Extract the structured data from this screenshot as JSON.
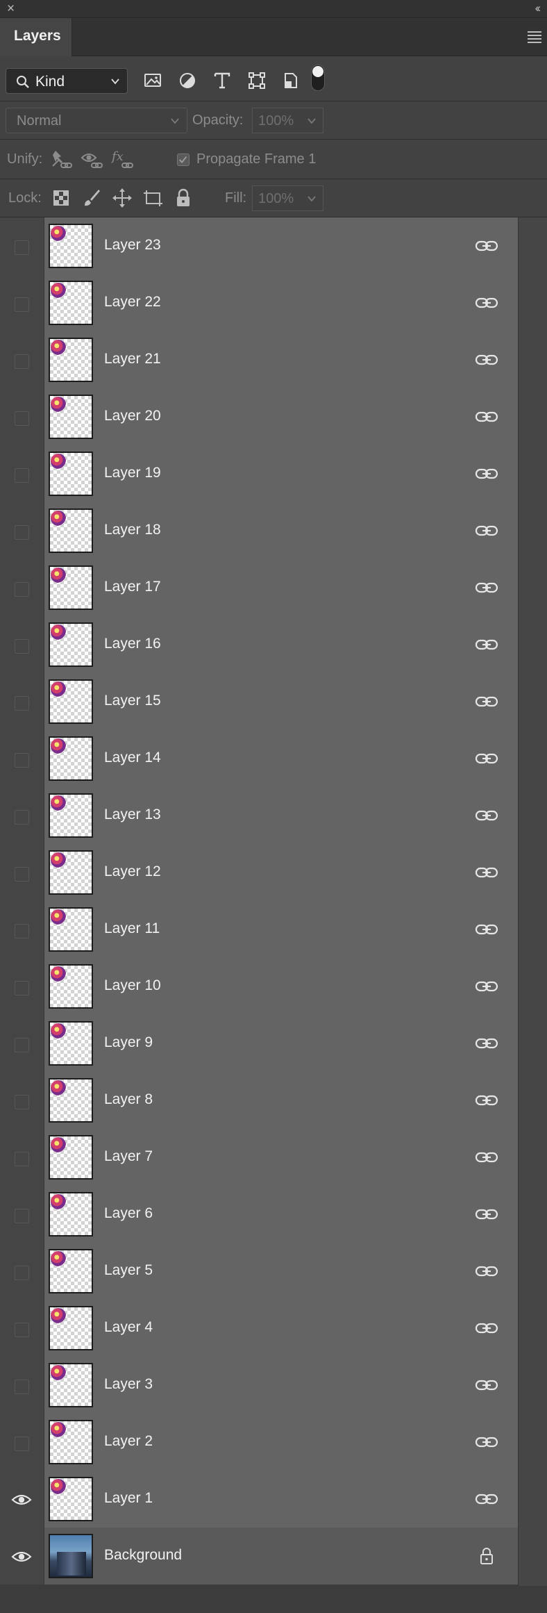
{
  "window": {
    "close_glyph": "×",
    "collapse_glyph": "‹‹"
  },
  "panel": {
    "title": "Layers",
    "menu_icon": "hamburger-menu-icon"
  },
  "filter": {
    "kind_label": "Kind",
    "icons": [
      "image-filter-icon",
      "adjustment-filter-icon",
      "type-filter-icon",
      "shape-filter-icon",
      "smart-object-filter-icon"
    ]
  },
  "blend": {
    "mode": "Normal",
    "opacity_label": "Opacity:",
    "opacity_value": "100%"
  },
  "unify": {
    "label": "Unify:",
    "propagate_label": "Propagate Frame 1",
    "propagate_checked": true
  },
  "lock": {
    "label": "Lock:",
    "fill_label": "Fill:",
    "fill_value": "100%"
  },
  "layers": [
    {
      "name": "Layer 23",
      "visible": false,
      "locked": false
    },
    {
      "name": "Layer 22",
      "visible": false,
      "locked": false
    },
    {
      "name": "Layer 21",
      "visible": false,
      "locked": false
    },
    {
      "name": "Layer 20",
      "visible": false,
      "locked": false
    },
    {
      "name": "Layer 19",
      "visible": false,
      "locked": false
    },
    {
      "name": "Layer 18",
      "visible": false,
      "locked": false
    },
    {
      "name": "Layer 17",
      "visible": false,
      "locked": false
    },
    {
      "name": "Layer 16",
      "visible": false,
      "locked": false
    },
    {
      "name": "Layer 15",
      "visible": false,
      "locked": false
    },
    {
      "name": "Layer 14",
      "visible": false,
      "locked": false
    },
    {
      "name": "Layer 13",
      "visible": false,
      "locked": false
    },
    {
      "name": "Layer 12",
      "visible": false,
      "locked": false
    },
    {
      "name": "Layer 11",
      "visible": false,
      "locked": false
    },
    {
      "name": "Layer 10",
      "visible": false,
      "locked": false
    },
    {
      "name": "Layer 9",
      "visible": false,
      "locked": false
    },
    {
      "name": "Layer 8",
      "visible": false,
      "locked": false
    },
    {
      "name": "Layer 7",
      "visible": false,
      "locked": false
    },
    {
      "name": "Layer 6",
      "visible": false,
      "locked": false
    },
    {
      "name": "Layer 5",
      "visible": false,
      "locked": false
    },
    {
      "name": "Layer 4",
      "visible": false,
      "locked": false
    },
    {
      "name": "Layer 3",
      "visible": false,
      "locked": false
    },
    {
      "name": "Layer 2",
      "visible": false,
      "locked": false
    },
    {
      "name": "Layer 1",
      "visible": true,
      "locked": false
    },
    {
      "name": "Background",
      "visible": true,
      "locked": true
    }
  ]
}
